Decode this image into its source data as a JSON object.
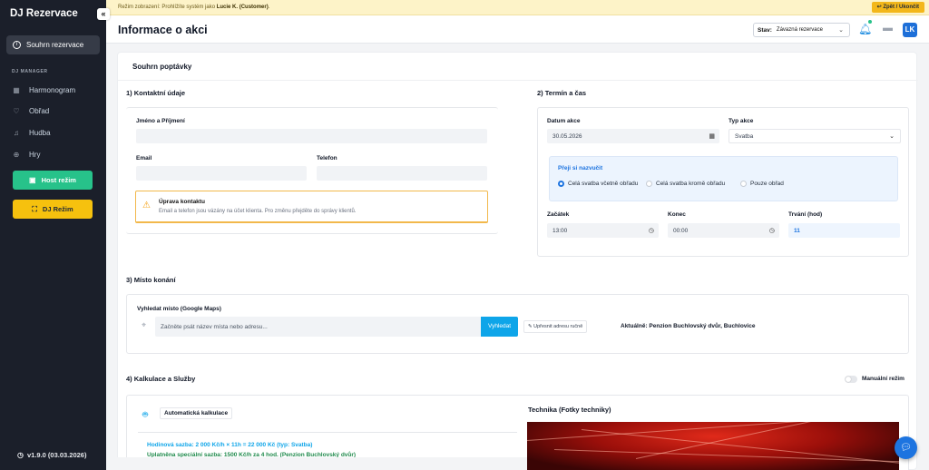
{
  "sidebar": {
    "brand": "DJ Rezervace",
    "collapse_symbol": "«",
    "active_item": "Souhrn rezervace",
    "section_label": "DJ MANAGER",
    "items": [
      {
        "label": "Harmonogram",
        "icon": "calendar-icon"
      },
      {
        "label": "Obřad",
        "icon": "heart-icon"
      },
      {
        "label": "Hudba",
        "icon": "music-icon"
      },
      {
        "label": "Hry",
        "icon": "gamepad-icon"
      }
    ],
    "host_mode": "Host režim",
    "dj_mode": "DJ Režim",
    "version": "v1.9.0 (03.03.2026)"
  },
  "banner": {
    "text_prefix": "Režim zobrazení: Prohlížíte systém jako",
    "user": "Lucie K. (Customer)",
    "text_suffix": ".",
    "back_button": "Zpět / Ukončit"
  },
  "header": {
    "title": "Informace o akci",
    "status_label": "Stav:",
    "status_value": "Závazná rezervace",
    "avatar_initials": "LK",
    "colors": {
      "accent": "#1d74e0",
      "success": "#27c28a",
      "warning": "#f6c10e"
    }
  },
  "main": {
    "card_title": "Souhrn poptávky",
    "contact": {
      "title": "1) Kontaktní údaje",
      "name_label": "Jméno a Příjmení",
      "name_value": "",
      "email_label": "Email",
      "email_value": "",
      "phone_label": "Telefon",
      "phone_value": "",
      "warning_title": "Úprava kontaktu",
      "warning_text": "Email a telefon jsou vázány na účet klienta. Pro změnu přejděte do správy klientů."
    },
    "term": {
      "title": "2) Termín a čas",
      "date_label": "Datum akce",
      "date_value": "30.05.2026",
      "type_label": "Typ akce",
      "type_value": "Svatba",
      "wish_title": "Přeji si nazvučit",
      "wish_options": [
        "Celá svatba včetně obřadu",
        "Celá svatba kromě obřadu",
        "Pouze obřad"
      ],
      "wish_selected": 0,
      "start_label": "Začátek",
      "start_value": "13:00",
      "end_label": "Konec",
      "end_value": "00:00",
      "duration_label": "Trvání (hod)",
      "duration_value": "11"
    },
    "venue": {
      "title": "3) Místo konání",
      "search_label": "Vyhledat místo (Google Maps)",
      "search_placeholder": "Začněte psát název místa nebo adresu...",
      "search_button": "Vyhledat",
      "refine_button": "Upřesnit adresu ručně",
      "current": "Aktuálně: Penzion Buchlovský dvůr, Buchlovice"
    },
    "calc": {
      "title": "4) Kalkulace a Služby",
      "manual_mode": "Manuální režim",
      "manual_enabled": false,
      "auto_label": "Automatická kalkulace",
      "rate_line": "Hodinová sazba: 2 000 Kč/h × 11h = 22 000 Kč (typ: Svatba)",
      "special_line": "Uplatněna speciální sazba: 1500 Kč/h za 4 hod. (Penzion Buchlovský dvůr)",
      "tech_title": "Technika (Fotky techniky)"
    }
  }
}
